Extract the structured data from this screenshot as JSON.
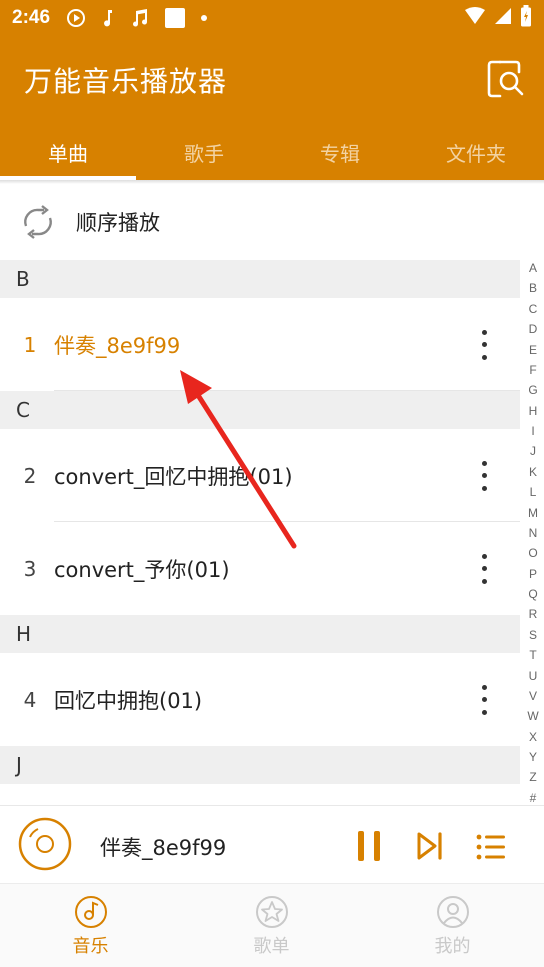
{
  "status": {
    "time": "2:46"
  },
  "app": {
    "title": "万能音乐播放器"
  },
  "tabs": [
    {
      "label": "单曲",
      "active": true
    },
    {
      "label": "歌手"
    },
    {
      "label": "专辑"
    },
    {
      "label": "文件夹"
    }
  ],
  "play_mode": {
    "label": "顺序播放"
  },
  "sections": [
    {
      "letter": "B",
      "songs": [
        {
          "index": "1",
          "name": "伴奏_8e9f99",
          "playing": true
        }
      ]
    },
    {
      "letter": "C",
      "songs": [
        {
          "index": "2",
          "name": "convert_回忆中拥抱(01)"
        },
        {
          "index": "3",
          "name": "convert_予你(01)"
        }
      ]
    },
    {
      "letter": "H",
      "songs": [
        {
          "index": "4",
          "name": "回忆中拥抱(01)"
        }
      ]
    },
    {
      "letter": "J",
      "songs": []
    }
  ],
  "alpha_index": [
    "A",
    "B",
    "C",
    "D",
    "E",
    "F",
    "G",
    "H",
    "I",
    "J",
    "K",
    "L",
    "M",
    "N",
    "O",
    "P",
    "Q",
    "R",
    "S",
    "T",
    "U",
    "V",
    "W",
    "X",
    "Y",
    "Z",
    "#"
  ],
  "mini_player": {
    "track": "伴奏_8e9f99"
  },
  "bottom_nav": [
    {
      "label": "音乐",
      "icon": "music-disc-icon",
      "active": true
    },
    {
      "label": "歌单",
      "icon": "star-icon"
    },
    {
      "label": "我的",
      "icon": "profile-icon"
    }
  ],
  "colors": {
    "accent": "#d78100"
  }
}
